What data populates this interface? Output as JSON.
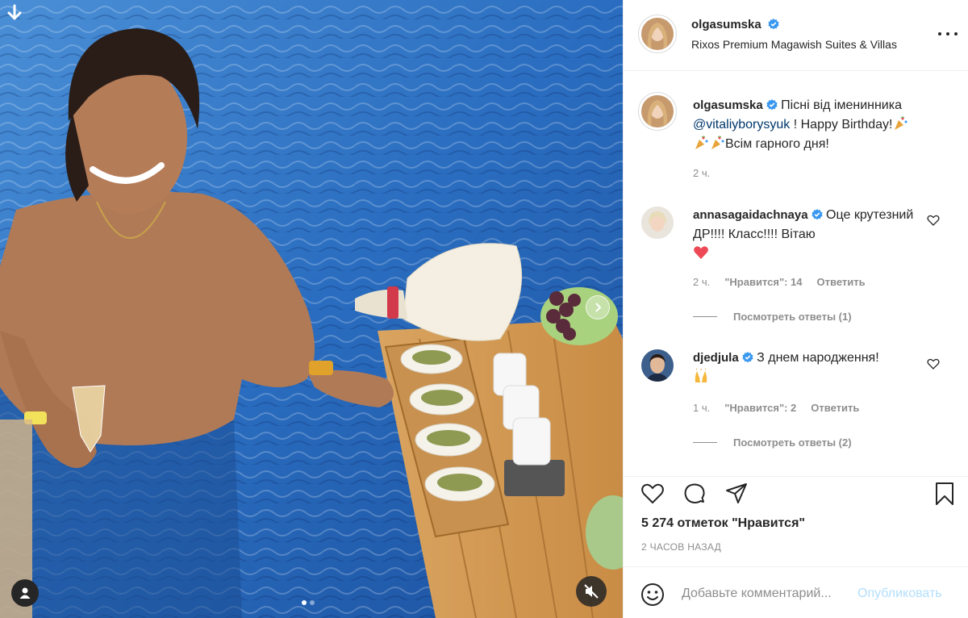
{
  "post": {
    "username": "olgasumska",
    "location": "Rixos Premium Magawish Suites & Villas",
    "caption": {
      "username": "olgasumska",
      "text_1": "Пісні від іменинника",
      "mention": "@vitaliyborysyuk",
      "text_2": " ! Happy Birthday!",
      "text_3": "Всім гарного дня!",
      "time": "2 ч."
    },
    "comments": [
      {
        "username": "annasagaidachnaya",
        "text_1": "Оце",
        "text_2": "крутезний ДР!!!! Класс!!!! Вітаю",
        "time": "2 ч.",
        "likes": "\"Нравится\": 14",
        "reply": "Ответить",
        "view_replies": "Посмотреть ответы (1)"
      },
      {
        "username": "djedjula",
        "text_1": "З днем народження!",
        "time": "1 ч.",
        "likes": "\"Нравится\": 2",
        "reply": "Ответить",
        "view_replies": "Посмотреть ответы (2)"
      }
    ],
    "likes_text": "5 274 отметок \"Нравится\"",
    "posted_ago": "2 часов назад",
    "add_comment_placeholder": "Добавьте комментарий...",
    "publish_label": "Опубликовать",
    "carousel": {
      "current": 1,
      "total": 2
    }
  },
  "icons": {
    "verified": "verified-badge-icon",
    "like": "heart-icon",
    "comment": "comment-bubble-icon",
    "share": "paper-plane-icon",
    "save": "bookmark-icon",
    "more": "more-dots-icon",
    "emoji": "smiley-icon",
    "mute": "mute-speaker-icon",
    "tag": "user-tag-icon",
    "next": "chevron-right-icon",
    "download": "arrow-down-icon"
  },
  "colors": {
    "verified": "#3897f0",
    "link": "#00376b",
    "muted": "#8e8e8e",
    "publish_disabled": "#b2dffc",
    "heart_red": "#ed4956"
  }
}
